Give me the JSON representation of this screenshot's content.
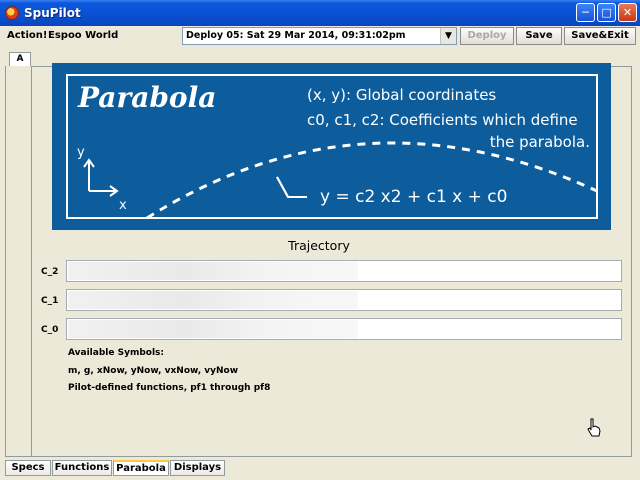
{
  "window": {
    "title": "SpuPilot"
  },
  "toolbar": {
    "action_label": "Action!",
    "world_label": "Espoo World",
    "deploy_value": "Deploy 05: Sat 29 Mar 2014, 09:31:02pm",
    "deploy_button": "Deploy",
    "save_button": "Save",
    "save_exit_button": "Save&Exit"
  },
  "side_tab": {
    "label": "A"
  },
  "banner": {
    "title": "Parabola",
    "line1": "(x, y): Global coordinates",
    "line2": "c0, c1, c2: Coefficients which define",
    "line3": "the parabola.",
    "axis_y": "y",
    "axis_x": "x",
    "equation": "y = c2 x2 + c1 x + c0"
  },
  "trajectory": {
    "title": "Trajectory",
    "fields": [
      {
        "label": "C_2"
      },
      {
        "label": "C_1"
      },
      {
        "label": "C_0"
      }
    ]
  },
  "notes": {
    "heading": "Available Symbols:",
    "symbols": "m, g, xNow, yNow, vxNow, vyNow",
    "functions": "Pilot-defined functions, pf1 through pf8"
  },
  "bottom_tabs": [
    {
      "label": "Specs"
    },
    {
      "label": "Functions"
    },
    {
      "label": "Parabola"
    },
    {
      "label": "Displays"
    }
  ],
  "colors": {
    "banner_bg": "#0d5c9c",
    "titlebar": "#0a4fd1",
    "active_tab_accent": "#ffc83c"
  }
}
